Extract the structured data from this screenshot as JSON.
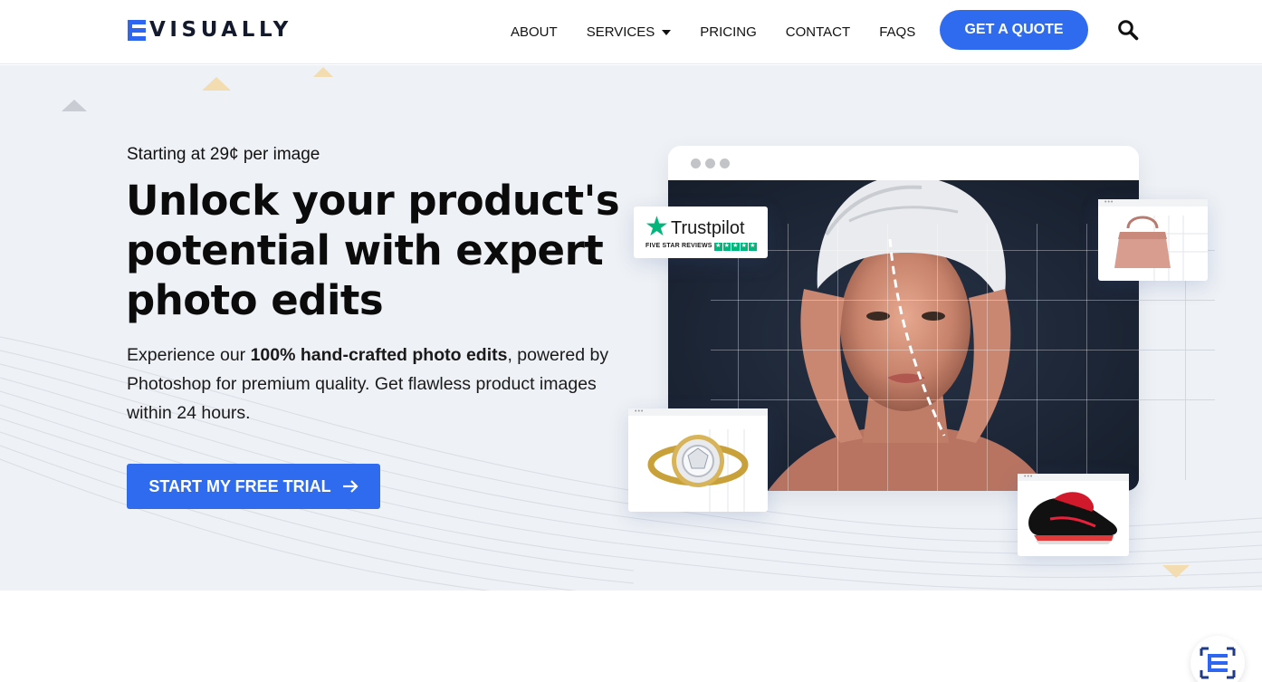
{
  "header": {
    "logo_text": "VISUALLY",
    "nav": [
      {
        "label": "ABOUT"
      },
      {
        "label": "SERVICES",
        "has_dropdown": true
      },
      {
        "label": "PRICING"
      },
      {
        "label": "CONTACT"
      },
      {
        "label": "FAQS"
      }
    ],
    "cta_label": "GET A QUOTE",
    "search_icon": "search-icon"
  },
  "hero": {
    "kicker": "Starting at 29¢ per image",
    "headline": "Unlock your product's potential with expert photo edits",
    "desc_prefix": "Experience our ",
    "desc_bold": "100% hand-crafted photo edits",
    "desc_suffix": ", powered by Photoshop for premium quality. Get flawless product images within 24 hours.",
    "cta_label": "START MY FREE TRIAL",
    "cta_icon": "arrow-right-icon"
  },
  "trustpilot": {
    "name": "Trustpilot",
    "subtitle": "FIVE STAR REVIEWS",
    "stars": 5
  },
  "colors": {
    "accent": "#2f6bef",
    "hero_bg": "#eef1f5",
    "trustpilot_green": "#00b67a",
    "triangle_gold": "#f3dcb0",
    "triangle_gray": "#c9ccd2"
  }
}
